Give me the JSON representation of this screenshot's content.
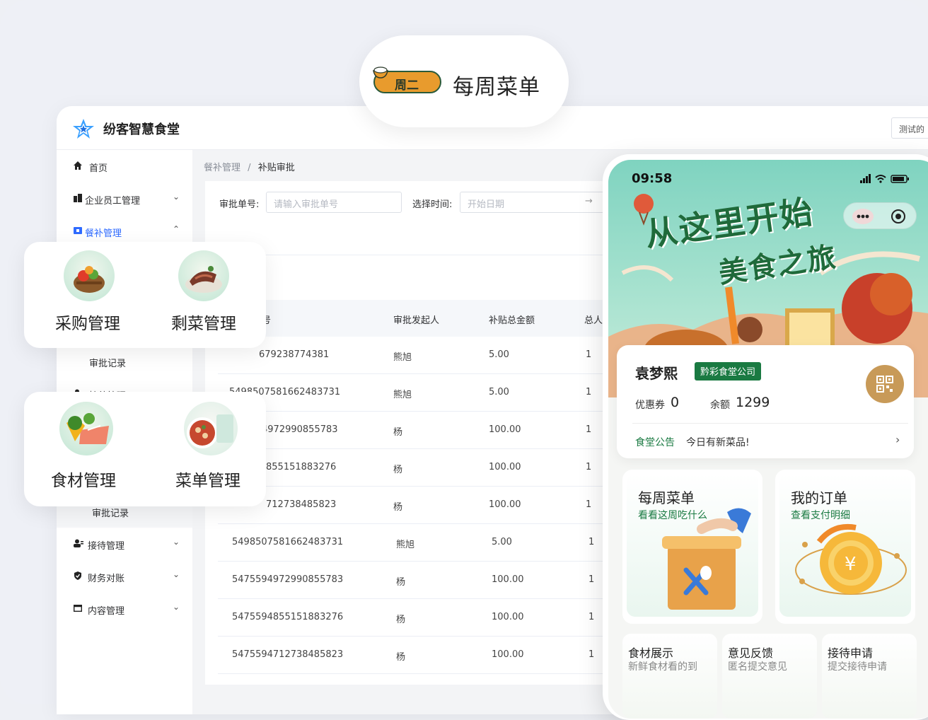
{
  "pill": {
    "badge": "周二",
    "title": "每周菜单"
  },
  "admin": {
    "brand": "纷客智慧食堂",
    "user_button": "测试的",
    "nav": [
      {
        "label": "首页"
      },
      {
        "label": "企业员工管理"
      },
      {
        "label": "餐补管理"
      },
      {
        "label": "审批记录"
      },
      {
        "label": "接待管理"
      },
      {
        "label": "审批记录"
      },
      {
        "label": "接待管理"
      },
      {
        "label": "财务对账"
      },
      {
        "label": "内容管理"
      }
    ],
    "breadcrumb": {
      "parent": "餐补管理",
      "sep": "/",
      "current": "补贴审批"
    },
    "filters": {
      "order_label": "审批单号:",
      "order_placeholder": "请输入审批单号",
      "time_label": "选择时间:",
      "date_placeholder": "开始日期",
      "arrow": "→"
    },
    "table": {
      "headers": [
        "号",
        "审批发起人",
        "补贴总金额",
        "总人"
      ],
      "rows": [
        {
          "id": "679238774381",
          "initiator": "熊旭",
          "amount": "5.00",
          "count": "1"
        },
        {
          "id": "5498507581662483731",
          "initiator": "熊旭",
          "amount": "5.00",
          "count": "1"
        },
        {
          "id": "4972990855783",
          "initiator": "杨",
          "amount": "100.00",
          "count": "1"
        },
        {
          "id": "855151883276",
          "initiator": "杨",
          "amount": "100.00",
          "count": "1"
        },
        {
          "id": "712738485823",
          "initiator": "杨",
          "amount": "100.00",
          "count": "1"
        },
        {
          "id": "5498507581662483731",
          "initiator": "熊旭",
          "amount": "5.00",
          "count": "1"
        },
        {
          "id": "5475594972990855783",
          "initiator": "杨",
          "amount": "100.00",
          "count": "1"
        },
        {
          "id": "5475594855151883276",
          "initiator": "杨",
          "amount": "100.00",
          "count": "1"
        },
        {
          "id": "5475594712738485823",
          "initiator": "杨",
          "amount": "100.00",
          "count": "1"
        }
      ]
    }
  },
  "float_cards": {
    "top": [
      "采购管理",
      "剩菜管理"
    ],
    "bottom": [
      "食材管理",
      "菜单管理"
    ]
  },
  "phone": {
    "time": "09:58",
    "slogan_line1": "从这里开始",
    "slogan_line2": "美食之旅",
    "user": {
      "name": "袁梦熙",
      "company": "黔彩食堂公司",
      "coupon_label": "优惠券",
      "coupon_value": "0",
      "balance_label": "余额",
      "balance_value": "1299",
      "notice_label": "食堂公告",
      "notice_text": "今日有新菜品!"
    },
    "features": [
      {
        "title": "每周菜单",
        "subtitle": "看看这周吃什么"
      },
      {
        "title": "我的订单",
        "subtitle": "查看支付明细"
      }
    ],
    "small_features": [
      {
        "title": "食材展示",
        "subtitle": "新鲜食材看的到"
      },
      {
        "title": "意见反馈",
        "subtitle": "匿名提交意见"
      },
      {
        "title": "接待申请",
        "subtitle": "提交接待申请"
      }
    ]
  },
  "colors": {
    "accent_blue": "#2f6bff",
    "brand_green": "#1a7a42",
    "gold": "#c89a58"
  }
}
